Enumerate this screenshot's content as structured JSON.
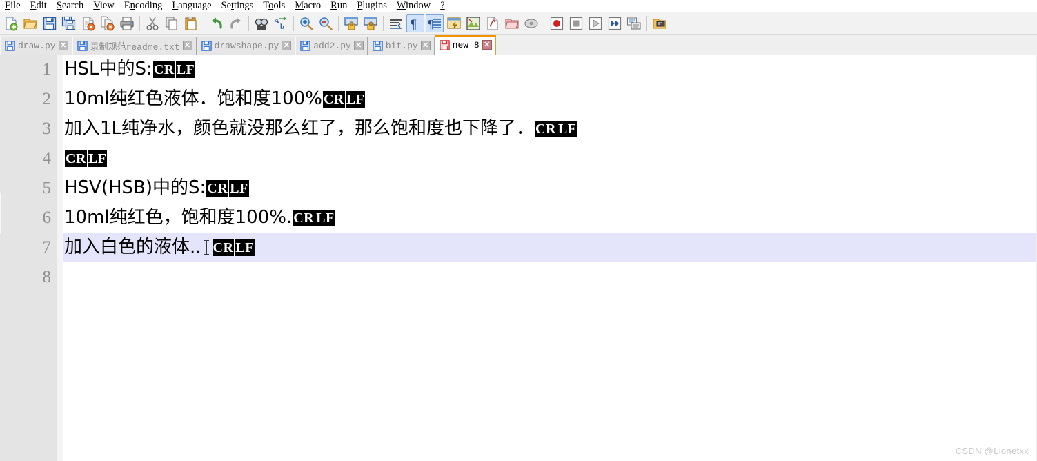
{
  "app": {
    "name": "Notepad++",
    "watermark": "CSDN @Lionetxx"
  },
  "menubar": {
    "items": [
      {
        "label": "File",
        "accel": "F"
      },
      {
        "label": "Edit",
        "accel": "E"
      },
      {
        "label": "Search",
        "accel": "S"
      },
      {
        "label": "View",
        "accel": "V"
      },
      {
        "label": "Encoding",
        "accel": "n"
      },
      {
        "label": "Language",
        "accel": "L"
      },
      {
        "label": "Settings",
        "accel": "t"
      },
      {
        "label": "Tools",
        "accel": "o"
      },
      {
        "label": "Macro",
        "accel": "M"
      },
      {
        "label": "Run",
        "accel": "R"
      },
      {
        "label": "Plugins",
        "accel": "P"
      },
      {
        "label": "Window",
        "accel": "W"
      },
      {
        "label": "?",
        "accel": "?"
      }
    ]
  },
  "toolbar": {
    "buttons": [
      {
        "name": "new-file-icon",
        "tip": "New"
      },
      {
        "name": "open-file-icon",
        "tip": "Open"
      },
      {
        "name": "save-icon",
        "tip": "Save"
      },
      {
        "name": "save-all-icon",
        "tip": "Save All"
      },
      {
        "name": "close-file-icon",
        "tip": "Close"
      },
      {
        "name": "close-all-files-icon",
        "tip": "Close All"
      },
      {
        "name": "print-icon",
        "tip": "Print"
      },
      {
        "name": "cut-icon",
        "tip": "Cut"
      },
      {
        "name": "copy-icon",
        "tip": "Copy"
      },
      {
        "name": "paste-icon",
        "tip": "Paste"
      },
      {
        "name": "undo-icon",
        "tip": "Undo"
      },
      {
        "name": "redo-icon",
        "tip": "Redo"
      },
      {
        "name": "find-icon",
        "tip": "Find"
      },
      {
        "name": "replace-icon",
        "tip": "Replace"
      },
      {
        "name": "zoom-in-icon",
        "tip": "Zoom In"
      },
      {
        "name": "zoom-out-icon",
        "tip": "Zoom Out"
      },
      {
        "name": "sync-vertical-scrolling-icon",
        "tip": "Synchronize Vertical Scrolling"
      },
      {
        "name": "sync-horizontal-scrolling-icon",
        "tip": "Synchronize Horizontal Scrolling"
      },
      {
        "name": "word-wrap-icon",
        "tip": "Word wrap"
      },
      {
        "name": "show-all-characters-icon",
        "tip": "Show All Characters",
        "active": true
      },
      {
        "name": "show-indent-guide-icon",
        "tip": "Show Indent Guide",
        "active": true
      },
      {
        "name": "user-defined-dialog-icon",
        "tip": "User Defined Dialogue"
      },
      {
        "name": "document-map-icon",
        "tip": "Document Map"
      },
      {
        "name": "function-list-icon",
        "tip": "Function List"
      },
      {
        "name": "folder-as-workspace-icon",
        "tip": "Folder as Workspace"
      },
      {
        "name": "monitoring-icon",
        "tip": "Monitoring"
      },
      {
        "name": "record-macro-icon",
        "tip": "Start Recording"
      },
      {
        "name": "stop-macro-icon",
        "tip": "Stop Recording"
      },
      {
        "name": "play-macro-icon",
        "tip": "Playback"
      },
      {
        "name": "run-macro-multiple-icon",
        "tip": "Run a Macro Multiple Times"
      },
      {
        "name": "save-macro-icon",
        "tip": "Save Current Recorded Macro"
      },
      {
        "name": "run-icon",
        "tip": "Run"
      }
    ]
  },
  "tabs": [
    {
      "label": "draw.py",
      "modified": false,
      "active": false
    },
    {
      "label": "录制规范readme.txt",
      "modified": false,
      "active": false
    },
    {
      "label": "drawshape.py",
      "modified": false,
      "active": false
    },
    {
      "label": "add2.py",
      "modified": false,
      "active": false
    },
    {
      "label": "bit.py",
      "modified": false,
      "active": false
    },
    {
      "label": "new  8",
      "modified": true,
      "active": true
    }
  ],
  "editor": {
    "eol_marker": {
      "cr": "CR",
      "lf": "LF"
    },
    "current_line": 7,
    "lines": [
      {
        "num": "1",
        "text": "HSL中的S:",
        "eol": true
      },
      {
        "num": "2",
        "text": "10ml纯红色液体．饱和度100%",
        "eol": true
      },
      {
        "num": "3",
        "text": "加入1L纯净水，颜色就没那么红了，那么饱和度也下降了．",
        "eol": true
      },
      {
        "num": "4",
        "text": "",
        "eol": true
      },
      {
        "num": "5",
        "text": "HSV(HSB)中的S:",
        "eol": true
      },
      {
        "num": "6",
        "text": "10ml纯红色，饱和度100%.",
        "eol": true
      },
      {
        "num": "7",
        "text": "加入白色的液体..",
        "eol": true,
        "cursor": true
      },
      {
        "num": "8",
        "text": "",
        "eol": false
      }
    ]
  },
  "colors": {
    "toolbar_bg": "#f2f2f2",
    "gutter_bg": "#e4e4e4",
    "line_number": "#8f8f8f",
    "current_line_highlight": "#e4e4fb",
    "active_tab_accent": "#f29400",
    "eol_marker_bg": "#000000",
    "eol_marker_fg": "#ffffff",
    "watermark": "#c9c9c9"
  }
}
